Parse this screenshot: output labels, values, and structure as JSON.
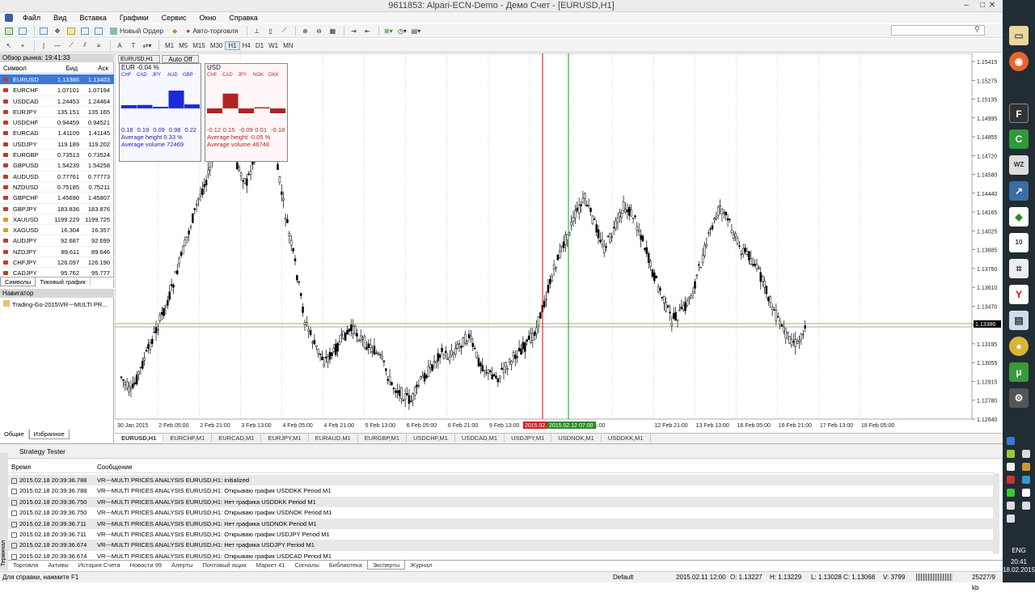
{
  "window": {
    "title": "9611853: Alpari-ECN-Demo - Демо Счет - [EURUSD,H1]",
    "min": "–",
    "max": "□",
    "close": "✕"
  },
  "menu": [
    "Файл",
    "Вид",
    "Вставка",
    "Графики",
    "Сервис",
    "Окно",
    "Справка"
  ],
  "toolbar": {
    "new_order": "Новый Ордер",
    "autotrade": "Авто-торговля"
  },
  "timeframes": [
    "M1",
    "M5",
    "M15",
    "M30",
    "H1",
    "H4",
    "D1",
    "W1",
    "MN"
  ],
  "timeframe_active": "H1",
  "market_watch": {
    "title": "Обзор рынка: 19:41:33",
    "col_symbol": "Символ",
    "col_bid": "Бид",
    "col_ask": "Аск",
    "rows": [
      {
        "s": "EURUSD",
        "b": "1.13386",
        "a": "1.13403"
      },
      {
        "s": "EURCHF",
        "b": "1.07101",
        "a": "1.07194"
      },
      {
        "s": "USDCAD",
        "b": "1.24453",
        "a": "1.24464"
      },
      {
        "s": "EURJPY",
        "b": "135.151",
        "a": "135.165"
      },
      {
        "s": "USDCHF",
        "b": "0.94459",
        "a": "0.94521"
      },
      {
        "s": "EURCAD",
        "b": "1.41109",
        "a": "1.41145"
      },
      {
        "s": "USDJPY",
        "b": "119.189",
        "a": "119.202"
      },
      {
        "s": "EURGBP",
        "b": "0.73513",
        "a": "0.73524"
      },
      {
        "s": "GBPUSD",
        "b": "1.54239",
        "a": "1.54258"
      },
      {
        "s": "AUDUSD",
        "b": "0.77761",
        "a": "0.77773"
      },
      {
        "s": "NZDUSD",
        "b": "0.75185",
        "a": "0.75211"
      },
      {
        "s": "GBPCHF",
        "b": "1.45690",
        "a": "1.45807"
      },
      {
        "s": "GBPJPY",
        "b": "183.836",
        "a": "183.876"
      },
      {
        "s": "XAUUSD",
        "b": "1199.229",
        "a": "1199.725"
      },
      {
        "s": "XAGUSD",
        "b": "16.304",
        "a": "16.357"
      },
      {
        "s": "AUDJPY",
        "b": "92.687",
        "a": "92.699"
      },
      {
        "s": "NZDJPY",
        "b": "89.611",
        "a": "89.646"
      },
      {
        "s": "CHFJPY",
        "b": "126.097",
        "a": "126.190"
      },
      {
        "s": "CADJPY",
        "b": "95.762",
        "a": "95.777"
      }
    ],
    "tabs": [
      "Символы",
      "Тиковый график"
    ]
  },
  "navigator": {
    "title": "Навигатор",
    "item": "Trading-Go-2015\\VR---MULTI PR...",
    "tabs": [
      "Общие",
      "Избранное"
    ]
  },
  "chart": {
    "symbol_label": "EURUSD,H1",
    "auto_off": "Auto Off",
    "price_levels": [
      "1.15415",
      "1.15275",
      "1.15135",
      "1.14995",
      "1.14855",
      "1.14720",
      "1.14580",
      "1.14440",
      "1.14165",
      "1.14025",
      "1.13885",
      "1.13750",
      "1.13610",
      "1.13470",
      "1.13330",
      "1.13195",
      "1.13055",
      "1.12915",
      "1.12780",
      "1.12640"
    ],
    "current_price": "1.13386",
    "time_labels": [
      "30 Jan 2015",
      "2 Feb 05:00",
      "2 Feb 21:00",
      "3 Feb 13:00",
      "4 Feb 05:00",
      "4 Feb 21:00",
      "5 Feb 13:00",
      "6 Feb 05:00",
      "6 Feb 21:00",
      "9 Feb 13:00",
      "10 Feb 05:00",
      "10 Feb 21:00",
      "",
      "12 Feb 21:00",
      "13 Feb 13:00",
      "16 Feb 05:00",
      "16 Feb 21:00",
      "17 Feb 13:00",
      "18 Feb 05:00"
    ],
    "red_line_label": "2015.02.11",
    "green_line_label": "2015.02.12 07:00",
    "panel_eur": {
      "title": "EUR -0.04 %",
      "currencies": [
        "CHF",
        "CAD",
        "JPY",
        "AUD",
        "GBP"
      ],
      "values": [
        "0.18",
        "0.19",
        "0.09",
        "0.98",
        "0.22"
      ],
      "bar_values": [
        0.18,
        0.19,
        0.09,
        0.98,
        0.22
      ],
      "avg_height": "Average height 0.33 %",
      "avg_volume": "Average volume 72469"
    },
    "panel_usd": {
      "title": "USD",
      "currencies": [
        "CHF",
        "CAD",
        "JPY",
        "NOK",
        "DKK"
      ],
      "values": [
        "-0.12",
        "0.15",
        "-0.09",
        "0.01",
        "-0.18"
      ],
      "bar_values": [
        -0.12,
        0.15,
        -0.09,
        0.01,
        -0.18
      ],
      "avg_height": "Average height -0.05 %",
      "avg_volume": "Average volume 46748"
    },
    "tabs": [
      "EURUSD,H1",
      "EURCHF,M1",
      "EURCAD,M1",
      "EURJPY,M1",
      "EURAUD,M1",
      "EURGBP,M1",
      "USDCHF,M1",
      "USDCAD,M1",
      "USDJPY,M1",
      "USDNOK,M1",
      "USDDKK,M1"
    ]
  },
  "terminal": {
    "tester": "Strategy Tester",
    "col_time": "Время",
    "col_msg": "Сообщение",
    "rows": [
      {
        "t": "2015.02.18 20:39:36.788",
        "m": "VR---MULTI PRICES ANALYSIS EURUSD,H1: initialized"
      },
      {
        "t": "2015.02.18 20:39:36.788",
        "m": "VR---MULTI PRICES ANALYSIS EURUSD,H1: Открываю график USDDKK Period M1"
      },
      {
        "t": "2015.02.18 20:39:36.750",
        "m": "VR---MULTI PRICES ANALYSIS EURUSD,H1: Нет графика  USDDKK Period M1"
      },
      {
        "t": "2015.02.18 20:39:36.750",
        "m": "VR---MULTI PRICES ANALYSIS EURUSD,H1: Открываю график USDNOK Period M1"
      },
      {
        "t": "2015.02.18 20:39:36.711",
        "m": "VR---MULTI PRICES ANALYSIS EURUSD,H1: Нет графика  USDNOK Period M1"
      },
      {
        "t": "2015.02.18 20:39:36.711",
        "m": "VR---MULTI PRICES ANALYSIS EURUSD,H1: Открываю график USDJPY Period M1"
      },
      {
        "t": "2015.02.18 20:39:36.674",
        "m": "VR---MULTI PRICES ANALYSIS EURUSD,H1: Нет графика  USDJPY Period M1"
      },
      {
        "t": "2015.02.18 20:39:36.674",
        "m": "VR---MULTI PRICES ANALYSIS EURUSD,H1: Открываю график USDCAD Period M1"
      }
    ],
    "tabs": [
      "Торговля",
      "Активы",
      "История Счета",
      "Новости 99",
      "Алерты",
      "Почтовый ящик",
      "Маркет 41",
      "Сигналы",
      "Библиотека",
      "Эксперты",
      "Журнал"
    ],
    "active_tab": "Эксперты",
    "side_label": "Терминал"
  },
  "status": {
    "help": "Для справки, нажмите F1",
    "profile": "Default",
    "time": "2015.02.11 12:00",
    "open": "O: 1.13227",
    "high": "H: 1.13229",
    "low": "L: 1.13028",
    "close": "C: 1.13068",
    "volume": "V: 3799",
    "traffic": "25227/9 kb"
  },
  "taskbar": {
    "lang": "ENG",
    "time": "20:41",
    "date": "18.02.2015"
  }
}
